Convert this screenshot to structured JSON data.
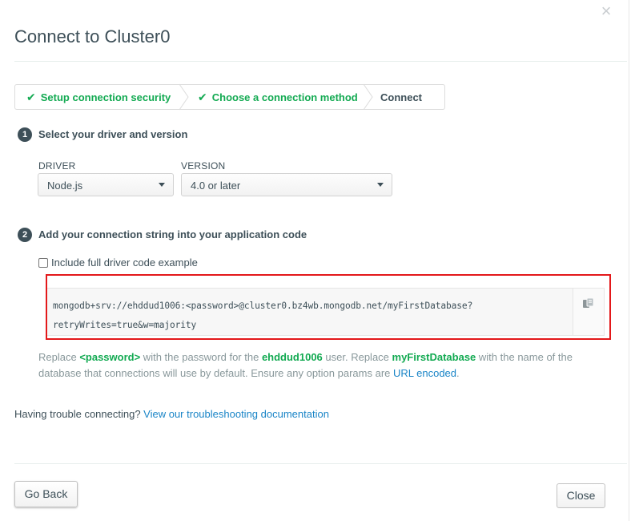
{
  "modal": {
    "title": "Connect to Cluster0",
    "close_symbol": "×"
  },
  "steps": [
    {
      "label": "Setup connection security",
      "status": "done"
    },
    {
      "label": "Choose a connection method",
      "status": "done"
    },
    {
      "label": "Connect",
      "status": "current"
    }
  ],
  "step_check_symbol": "✔",
  "section1": {
    "number": "1",
    "title": "Select your driver and version",
    "driver_label": "DRIVER",
    "driver_value": "Node.js",
    "version_label": "VERSION",
    "version_value": "4.0 or later"
  },
  "section2": {
    "number": "2",
    "title": "Add your connection string into your application code",
    "checkbox_label": "Include full driver code example",
    "checkbox_checked": false,
    "connection_string_line1": "mongodb+srv://ehddud1006:<password>@cluster0.bz4wb.mongodb.net/myFirstDatabase?",
    "connection_string_line2": "retryWrites=true&w=majority",
    "copy_icon": "copy-icon"
  },
  "note": {
    "t1": "Replace ",
    "password": "<password>",
    "t2": " with the password for the ",
    "user": "ehddud1006",
    "t3": " user. Replace ",
    "db": "myFirstDatabase",
    "t4": " with the name of the database that connections will use by default. Ensure any option params are ",
    "link": "URL encoded",
    "t5": "."
  },
  "trouble": {
    "text": "Having trouble connecting? ",
    "link": "View our troubleshooting documentation"
  },
  "buttons": {
    "back": "Go Back",
    "close": "Close"
  },
  "colors": {
    "accent_green": "#13aa52",
    "link_blue": "#1a85c7",
    "highlight_red": "#e3181a",
    "text": "#3d4f58"
  }
}
